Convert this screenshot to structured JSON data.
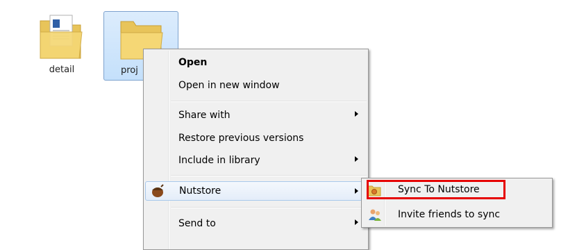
{
  "desktop": {
    "files": [
      {
        "label": "detail",
        "icon": "folder-with-document-icon"
      },
      {
        "label": "proj",
        "icon": "folder-icon"
      }
    ]
  },
  "context_menu": {
    "items": [
      {
        "label": "Open",
        "bold": true
      },
      {
        "label": "Open in new window"
      },
      {
        "label": "Share with",
        "submenu": true
      },
      {
        "label": "Restore previous versions"
      },
      {
        "label": "Include in library",
        "submenu": true
      },
      {
        "label": "Nutstore",
        "submenu": true,
        "icon": "acorn-icon",
        "highlighted": true
      },
      {
        "label": "Send to",
        "submenu": true
      }
    ]
  },
  "sub_menu": {
    "items": [
      {
        "label": "Sync To Nutstore",
        "icon": "nutstore-folder-icon",
        "emphasized": true
      },
      {
        "label": "Invite friends to sync",
        "icon": "users-icon"
      }
    ]
  },
  "colors": {
    "selection_bg": "#cce4fb",
    "selection_border": "#7da2ce",
    "emphasis_box": "#e60000",
    "menu_bg": "#f0f0f0"
  }
}
